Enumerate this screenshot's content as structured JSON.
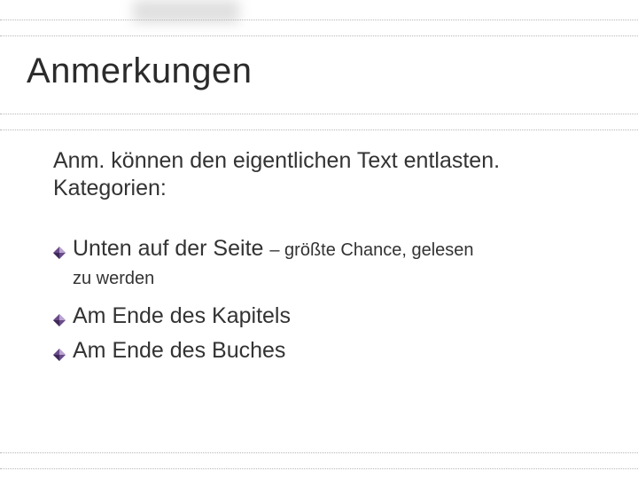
{
  "title": "Anmerkungen",
  "intro": "Anm. können den eigentlichen Text entlasten. Kategorien:",
  "items": [
    {
      "main": "Unten auf der Seite ",
      "sub": "– größte Chance, gelesen",
      "cont": "zu werden"
    },
    {
      "main": "Am Ende des Kapitels"
    },
    {
      "main": "Am Ende des Buches"
    }
  ]
}
